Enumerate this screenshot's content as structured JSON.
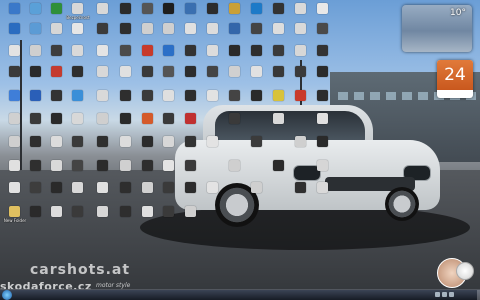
{
  "desktop": {
    "icons": [
      {
        "label": "",
        "color": "#3a78c9"
      },
      {
        "label": "",
        "color": "#5aa0d8"
      },
      {
        "label": "",
        "color": "#2f8f3a"
      },
      {
        "label": "Bezpečnost",
        "color": "#d8d8d8"
      },
      {
        "label": "",
        "color": "#d8d8d8"
      },
      {
        "label": "",
        "color": "#2a2a2a"
      },
      {
        "label": "",
        "color": "#555555"
      },
      {
        "label": "",
        "color": "#1e1e1e"
      },
      {
        "label": "",
        "color": "#3a6fb0"
      },
      {
        "label": "",
        "color": "#2c2c2c"
      },
      {
        "label": "",
        "color": "#c9a038"
      },
      {
        "label": "",
        "color": "#1d7ac8"
      },
      {
        "label": "",
        "color": "#333333"
      },
      {
        "label": "",
        "color": "#d9d9d9"
      },
      {
        "label": "",
        "color": "#e8e8e8"
      },
      {
        "label": "",
        "color": "#2a6cc0"
      },
      {
        "label": "",
        "color": "#5b9bd5"
      },
      {
        "label": "",
        "color": "#d6d6d6"
      },
      {
        "label": "",
        "color": "#e6e6e6"
      },
      {
        "label": "",
        "color": "#3b3b3b"
      },
      {
        "label": "",
        "color": "#2e2e2e"
      },
      {
        "label": "",
        "color": "#cfcfcf"
      },
      {
        "label": "",
        "color": "#cfcfcf"
      },
      {
        "label": "",
        "color": "#e0e0e0"
      },
      {
        "label": "",
        "color": "#dcdcdc"
      },
      {
        "label": "",
        "color": "#3366aa"
      },
      {
        "label": "",
        "color": "#444444"
      },
      {
        "label": "",
        "color": "#dddddd"
      },
      {
        "label": "",
        "color": "#d9d9d9"
      },
      {
        "label": "",
        "color": "#4a4a4a"
      },
      {
        "label": "",
        "color": "#e3e3e3"
      },
      {
        "label": "",
        "color": "#cfcfcf"
      },
      {
        "label": "",
        "color": "#3d3d3d"
      },
      {
        "label": "",
        "color": "#d9d9d9"
      },
      {
        "label": "",
        "color": "#e4e4e4"
      },
      {
        "label": "",
        "color": "#4b4b4b"
      },
      {
        "label": "",
        "color": "#c83a2a"
      },
      {
        "label": "",
        "color": "#2b6fc7"
      },
      {
        "label": "",
        "color": "#333333"
      },
      {
        "label": "",
        "color": "#dcdcdc"
      },
      {
        "label": "",
        "color": "#2a2a2a"
      },
      {
        "label": "",
        "color": "#2e2e2e"
      },
      {
        "label": "",
        "color": "#3a3a3a"
      },
      {
        "label": "",
        "color": "#d7d7d7"
      },
      {
        "label": "",
        "color": "#333333"
      },
      {
        "label": "",
        "color": "#3a3a3a"
      },
      {
        "label": "",
        "color": "#2a2a2a"
      },
      {
        "label": "",
        "color": "#c43b2f"
      },
      {
        "label": "",
        "color": "#2e2e2e"
      },
      {
        "label": "",
        "color": "#d8d8d8"
      },
      {
        "label": "",
        "color": "#e0e0e0"
      },
      {
        "label": "",
        "color": "#3a3a3a"
      },
      {
        "label": "",
        "color": "#555555"
      },
      {
        "label": "",
        "color": "#2c2c2c"
      },
      {
        "label": "",
        "color": "#444444"
      },
      {
        "label": "",
        "color": "#d0d0d0"
      },
      {
        "label": "",
        "color": "#e1e1e1"
      },
      {
        "label": "",
        "color": "#383838"
      },
      {
        "label": "",
        "color": "#3a3a3a"
      },
      {
        "label": "",
        "color": "#2b2b2b"
      },
      {
        "label": "",
        "color": "#3f7ed8"
      },
      {
        "label": "",
        "color": "#2a5fb8"
      },
      {
        "label": "",
        "color": "#333333"
      },
      {
        "label": "",
        "color": "#3a8fd8"
      },
      {
        "label": "",
        "color": "#d9d9d9"
      },
      {
        "label": "",
        "color": "#2e2e2e"
      },
      {
        "label": "",
        "color": "#3a3a3a"
      },
      {
        "label": "",
        "color": "#dfdfdf"
      },
      {
        "label": "",
        "color": "#2d2d2d"
      },
      {
        "label": "",
        "color": "#e2e2e2"
      },
      {
        "label": "",
        "color": "#444444"
      },
      {
        "label": "",
        "color": "#2a2a2a"
      },
      {
        "label": "",
        "color": "#d8c23a"
      },
      {
        "label": "",
        "color": "#c93a2b"
      },
      {
        "label": "",
        "color": "#2c2c2c"
      },
      {
        "label": "",
        "color": "#d0d0d0"
      },
      {
        "label": "",
        "color": "#3a3a3a"
      },
      {
        "label": "",
        "color": "#2a2a2a"
      },
      {
        "label": "",
        "color": "#d8d8d8"
      },
      {
        "label": "",
        "color": "#cfcfcf"
      },
      {
        "label": "",
        "color": "#2a2a2a"
      },
      {
        "label": "",
        "color": "#d55a2a"
      },
      {
        "label": "",
        "color": "#3a3a3a"
      },
      {
        "label": "",
        "color": "#c03030"
      },
      {
        "label": "",
        "color": "#3a3a3a"
      },
      {
        "label": "",
        "color": "#d9d9d9"
      },
      {
        "label": "",
        "color": "#e0e0e0"
      },
      {
        "label": "",
        "color": "#cfcfcf"
      },
      {
        "label": "",
        "color": "#2e2e2e"
      },
      {
        "label": "",
        "color": "#dcdcdc"
      },
      {
        "label": "",
        "color": "#3a3a3a"
      },
      {
        "label": "",
        "color": "#2f2f2f"
      },
      {
        "label": "",
        "color": "#dcdcdc"
      },
      {
        "label": "",
        "color": "#2b2b2b"
      },
      {
        "label": "",
        "color": "#d7d7d7"
      },
      {
        "label": "",
        "color": "#333333"
      },
      {
        "label": "",
        "color": "#e3e3e3"
      },
      {
        "label": "",
        "color": "#3b3b3b"
      },
      {
        "label": "",
        "color": "#cfcfcf"
      },
      {
        "label": "",
        "color": "#2a2a2a"
      },
      {
        "label": "",
        "color": "#e0e0e0"
      },
      {
        "label": "",
        "color": "#2f2f2f"
      },
      {
        "label": "",
        "color": "#d9d9d9"
      },
      {
        "label": "",
        "color": "#444444"
      },
      {
        "label": "",
        "color": "#2b2b2b"
      },
      {
        "label": "",
        "color": "#d0d0d0"
      },
      {
        "label": "",
        "color": "#2e2e2e"
      },
      {
        "label": "",
        "color": "#e4e4e4"
      },
      {
        "label": "",
        "color": "#3a3a3a"
      },
      {
        "label": "",
        "color": "#cfcfcf"
      },
      {
        "label": "",
        "color": "#2a2a2a"
      },
      {
        "label": "",
        "color": "#d6d6d6"
      },
      {
        "label": "",
        "color": "#e1e1e1"
      },
      {
        "label": "",
        "color": "#3d3d3d"
      },
      {
        "label": "",
        "color": "#2a2a2a"
      },
      {
        "label": "",
        "color": "#d8d8d8"
      },
      {
        "label": "",
        "color": "#e0e0e0"
      },
      {
        "label": "",
        "color": "#2e2e2e"
      },
      {
        "label": "",
        "color": "#d0d0d0"
      },
      {
        "label": "",
        "color": "#3a3a3a"
      },
      {
        "label": "",
        "color": "#2c2c2c"
      },
      {
        "label": "",
        "color": "#e3e3e3"
      },
      {
        "label": "",
        "color": "#cfcfcf"
      },
      {
        "label": "",
        "color": "#2f2f2f"
      },
      {
        "label": "",
        "color": "#d9d9d9"
      },
      {
        "label": "New Folder",
        "color": "#e0c060"
      },
      {
        "label": "",
        "color": "#2a2a2a"
      },
      {
        "label": "",
        "color": "#dcdcdc"
      },
      {
        "label": "",
        "color": "#3a3a3a"
      },
      {
        "label": "",
        "color": "#d7d7d7"
      },
      {
        "label": "",
        "color": "#2e2e2e"
      },
      {
        "label": "",
        "color": "#e0e0e0"
      },
      {
        "label": "",
        "color": "#3a3a3a"
      },
      {
        "label": "",
        "color": "#cfcfcf"
      }
    ]
  },
  "gadgets": {
    "weather": {
      "temperature": "10°"
    },
    "calendar": {
      "day": "24"
    }
  },
  "watermark": {
    "brand": "carshots.at",
    "tagline": "motor style",
    "site": "skodaforce.cz"
  },
  "colors": {
    "accent": "#c9581e",
    "taskbar": "#1e2636"
  }
}
